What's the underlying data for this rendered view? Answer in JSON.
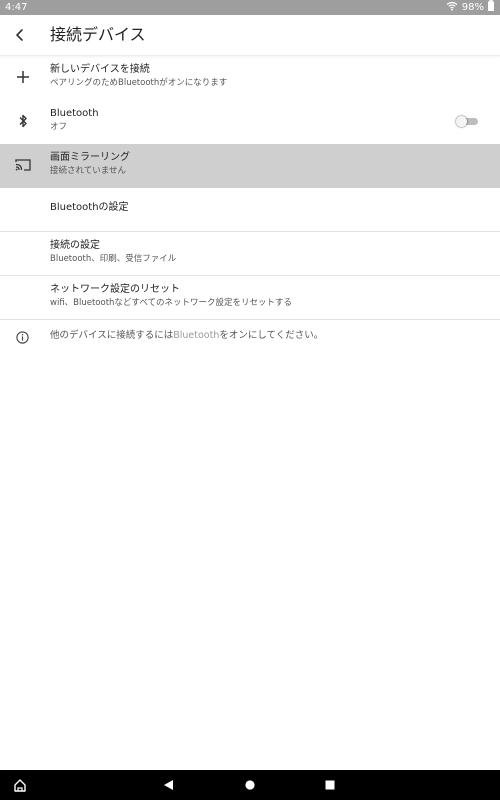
{
  "status_bar": {
    "time": "4:47",
    "battery": "98%"
  },
  "app_bar": {
    "title": "接続デバイス"
  },
  "rows": [
    {
      "primary": "新しいデバイスを接続",
      "secondary": "ペアリングのためBluetoothがオンになります"
    },
    {
      "primary": "Bluetooth",
      "secondary": "オフ",
      "toggle_on": false
    },
    {
      "primary": "画面ミラーリング",
      "secondary": "接続されていません"
    },
    {
      "primary": "Bluetoothの設定"
    },
    {
      "primary": "接続の設定",
      "secondary": "Bluetooth、印刷、受信ファイル"
    },
    {
      "primary": "ネットワーク設定のリセット",
      "secondary": "wifi、Bluetoothなどすべてのネットワーク設定をリセットする"
    }
  ],
  "info": {
    "prefix": "他のデバイスに接続するには",
    "highlight": "Bluetooth",
    "suffix": "をオンにしてください。"
  },
  "colors": {
    "status_bar": "#9e9e9e",
    "selected_row": "#cfcfcf",
    "nav_bar": "#000000"
  },
  "icons": [
    "back-arrow-icon",
    "plus-icon",
    "bluetooth-icon",
    "cast-icon",
    "info-icon",
    "wifi-icon",
    "battery-icon",
    "home-icon",
    "nav-back-icon",
    "nav-home-icon",
    "nav-recents-icon"
  ]
}
